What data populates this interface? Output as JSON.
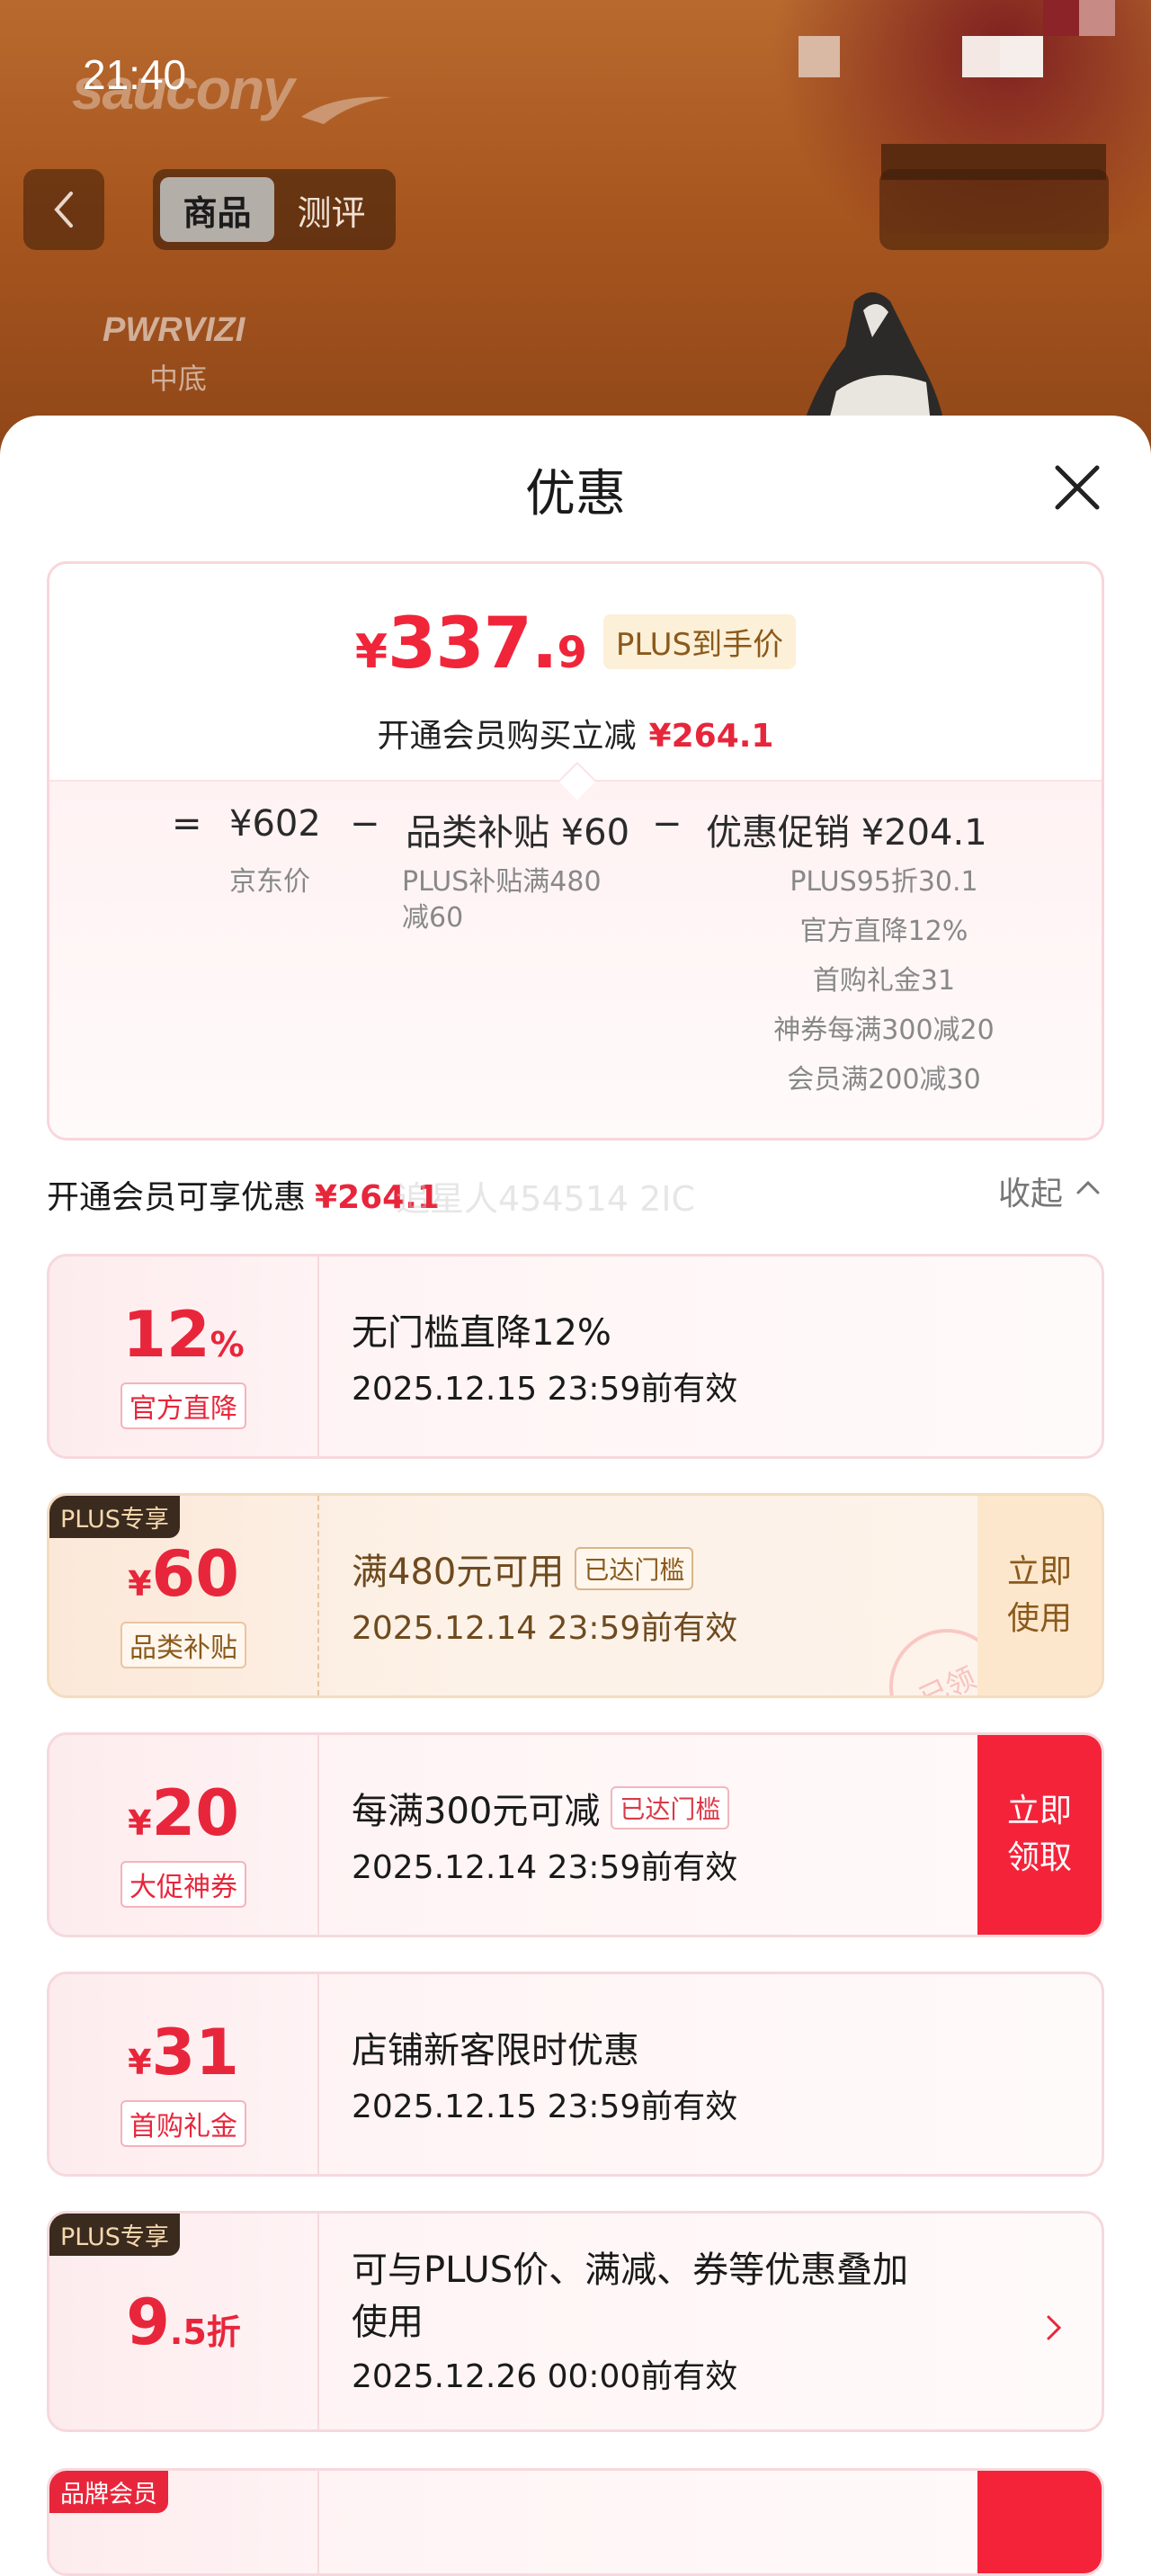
{
  "status_bar": {
    "time": "21:40"
  },
  "hero": {
    "brand": "saucony",
    "tech_label": "PWRVIZI",
    "tech_sub": "中底"
  },
  "nav": {
    "tabs": [
      {
        "label": "商品",
        "active": true
      },
      {
        "label": "测评",
        "active": false
      }
    ]
  },
  "sheet": {
    "title": "优惠",
    "price_card": {
      "currency": "¥",
      "price_int": "337.",
      "price_dec": "9",
      "plus_tag": "PLUS到手价",
      "member_text": "开通会员购买立减",
      "member_amount": "¥264.1",
      "formula": {
        "equals": "=",
        "jd_price": "¥602",
        "jd_label": "京东价",
        "minus1": "−",
        "subsidy": "品类补贴 ¥60",
        "subsidy_desc": [
          "PLUS补贴满480",
          "减60"
        ],
        "minus2": "−",
        "promo": "优惠促销 ¥204.1",
        "promo_desc": [
          "PLUS95折30.1",
          "官方直降12%",
          "首购礼金31",
          "神券每满300减20",
          "会员满200减30"
        ]
      }
    },
    "section": {
      "title": "开通会员可享优惠",
      "amount": "¥264.1",
      "watermark": "追星人454514 2IC",
      "collapse": "收起"
    },
    "coupons": [
      {
        "amount_big": "12",
        "amount_suffix": "%",
        "tag": "官方直降",
        "title": "无门槛直降12%",
        "date": "2025.12.15 23:59前有效"
      },
      {
        "badge": "PLUS专享",
        "amount_prefix": "¥",
        "amount_big": "60",
        "tag": "品类补贴",
        "title": "满480元可用",
        "reach": "已达门槛",
        "date": "2025.12.14 23:59前有效",
        "action": [
          "立即",
          "使用"
        ],
        "stamp": "已领"
      },
      {
        "amount_prefix": "¥",
        "amount_big": "20",
        "tag": "大促神券",
        "title": "每满300元可减",
        "reach": "已达门槛",
        "date": "2025.12.14 23:59前有效",
        "action": [
          "立即",
          "领取"
        ]
      },
      {
        "amount_prefix": "¥",
        "amount_big": "31",
        "tag": "首购礼金",
        "title": "店铺新客限时优惠",
        "date": "2025.12.15 23:59前有效"
      },
      {
        "badge": "PLUS专享",
        "amount_big": "9",
        "amount_suffix": ".5折",
        "title_line1": "可与PLUS价、满减、券等优惠叠加",
        "title_line2": "使用",
        "date": "2025.12.26 00:00前有效"
      },
      {
        "badge": "品牌会员"
      }
    ]
  },
  "colors": {
    "accent_red": "#e8263b",
    "plus_gold": "#8a5a1c",
    "plus_badge_bg": "#3b2a1e"
  }
}
